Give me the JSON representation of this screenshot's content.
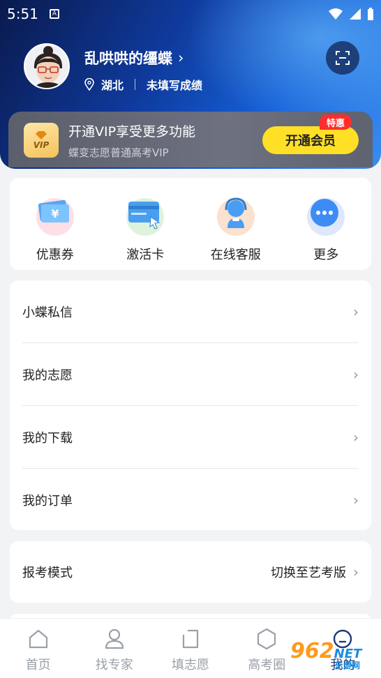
{
  "status_bar": {
    "time": "5:51"
  },
  "profile": {
    "username": "乱哄哄的缰蝶",
    "region": "湖北",
    "score_status": "未填写成绩"
  },
  "vip": {
    "badge_text": "VIP",
    "title": "开通VIP享受更多功能",
    "subtitle": "蝶变志愿普通高考VIP",
    "button_label": "开通会员",
    "tag": "特惠"
  },
  "quick_actions": [
    {
      "label": "优惠券",
      "icon": "coupon-icon"
    },
    {
      "label": "激活卡",
      "icon": "card-icon"
    },
    {
      "label": "在线客服",
      "icon": "customer-service-icon"
    },
    {
      "label": "更多",
      "icon": "more-icon"
    }
  ],
  "menu": [
    {
      "label": "小蝶私信"
    },
    {
      "label": "我的志愿"
    },
    {
      "label": "我的下载"
    },
    {
      "label": "我的订单"
    }
  ],
  "mode": {
    "label": "报考模式",
    "action": "切换至艺考版"
  },
  "tabs": [
    {
      "label": "首页",
      "icon": "home-icon"
    },
    {
      "label": "找专家",
      "icon": "person-icon"
    },
    {
      "label": "填志愿",
      "icon": "form-icon"
    },
    {
      "label": "高考圈",
      "icon": "hexagon-icon"
    },
    {
      "label": "我的",
      "icon": "profile-icon"
    }
  ],
  "watermark": {
    "main": "962",
    "suffix": "NET",
    "sub": "乐游网"
  },
  "colors": {
    "accent_yellow": "#ffe026",
    "tag_red": "#ff2d2d",
    "hero_blue": "#1560d8"
  }
}
